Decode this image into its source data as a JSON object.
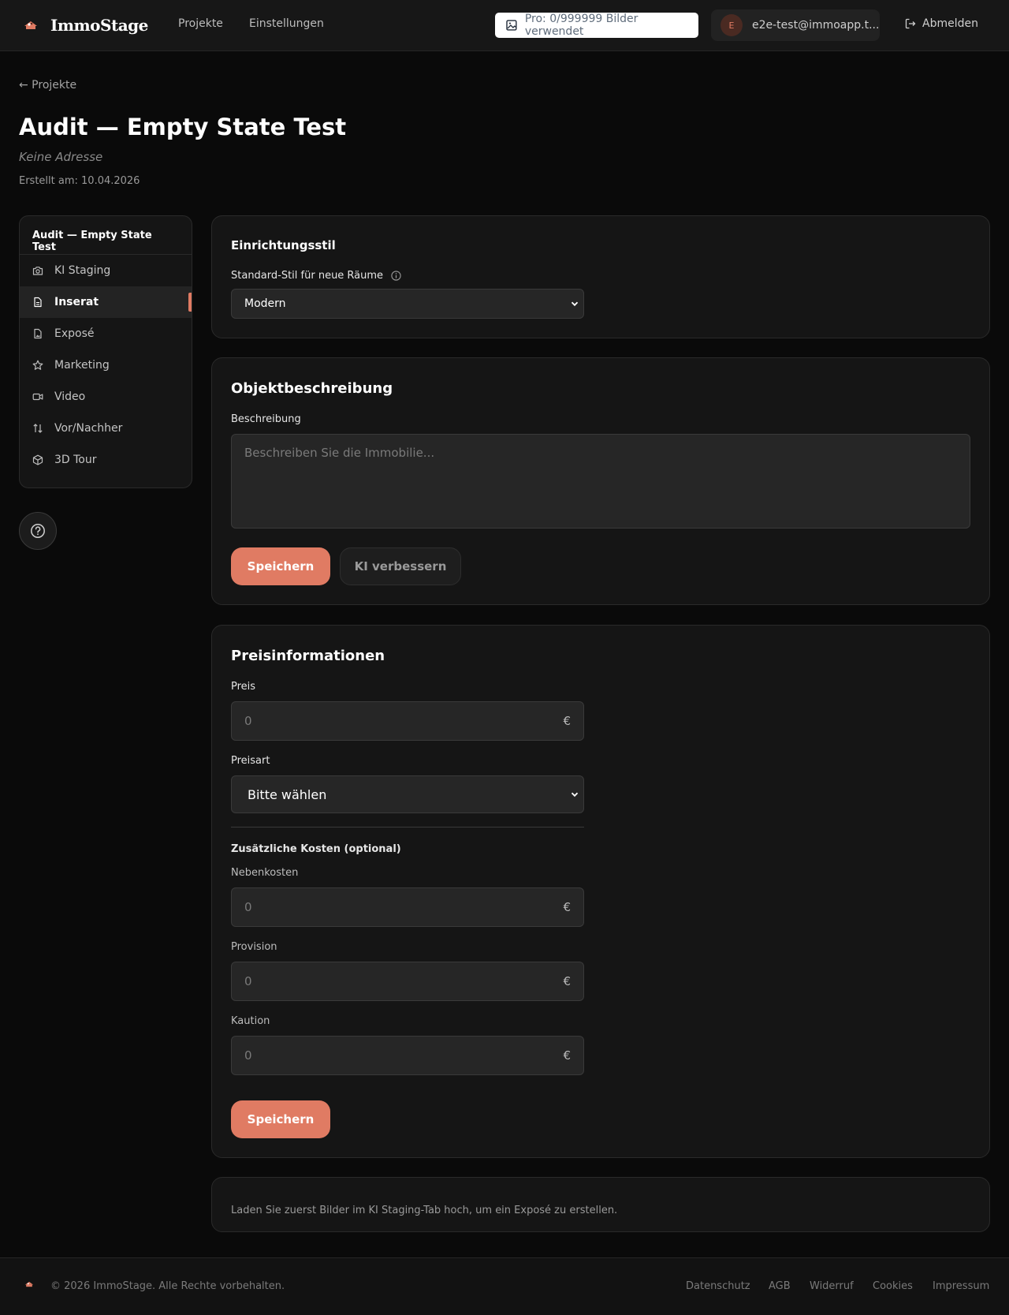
{
  "header": {
    "brand": "ImmoStage",
    "nav": [
      "Projekte",
      "Einstellungen"
    ],
    "usage": "Pro: 0/999999 Bilder verwendet",
    "user_initial": "E",
    "user_email": "e2e-test@immoapp.t...",
    "logout": "Abmelden"
  },
  "page": {
    "back": "← Projekte",
    "title": "Audit — Empty State Test",
    "address": "Keine Adresse",
    "created": "Erstellt am: 10.04.2026"
  },
  "sidebar": {
    "title": "Audit — Empty State Test",
    "items": [
      {
        "label": "KI Staging",
        "icon": "camera-icon"
      },
      {
        "label": "Inserat",
        "icon": "document-icon",
        "active": true
      },
      {
        "label": "Exposé",
        "icon": "file-image-icon"
      },
      {
        "label": "Marketing",
        "icon": "star-icon"
      },
      {
        "label": "Video",
        "icon": "video-icon"
      },
      {
        "label": "Vor/Nachher",
        "icon": "swap-icon"
      },
      {
        "label": "3D Tour",
        "icon": "cube-icon"
      }
    ]
  },
  "style_card": {
    "title": "Einrichtungsstil",
    "label": "Standard-Stil für neue Räume",
    "value": "Modern"
  },
  "description_card": {
    "title": "Objektbeschreibung",
    "label": "Beschreibung",
    "placeholder": "Beschreiben Sie die Immobilie...",
    "save": "Speichern",
    "improve": "KI verbessern"
  },
  "price_card": {
    "title": "Preisinformationen",
    "price_label": "Preis",
    "price_placeholder": "0",
    "currency": "€",
    "price_type_label": "Preisart",
    "price_type_value": "Bitte wählen",
    "extra_heading": "Zusätzliche Kosten (optional)",
    "extras": [
      {
        "label": "Nebenkosten",
        "placeholder": "0"
      },
      {
        "label": "Provision",
        "placeholder": "0"
      },
      {
        "label": "Kaution",
        "placeholder": "0"
      }
    ],
    "save": "Speichern"
  },
  "expose_hint": "Laden Sie zuerst Bilder im KI Staging-Tab hoch, um ein Exposé zu erstellen.",
  "footer": {
    "copyright": "© 2026 ImmoStage. Alle Rechte vorbehalten.",
    "links": [
      "Datenschutz",
      "AGB",
      "Widerruf",
      "Cookies",
      "Impressum"
    ]
  },
  "colors": {
    "accent": "#e07b63",
    "background": "#0a0a0a",
    "card": "#151515"
  }
}
